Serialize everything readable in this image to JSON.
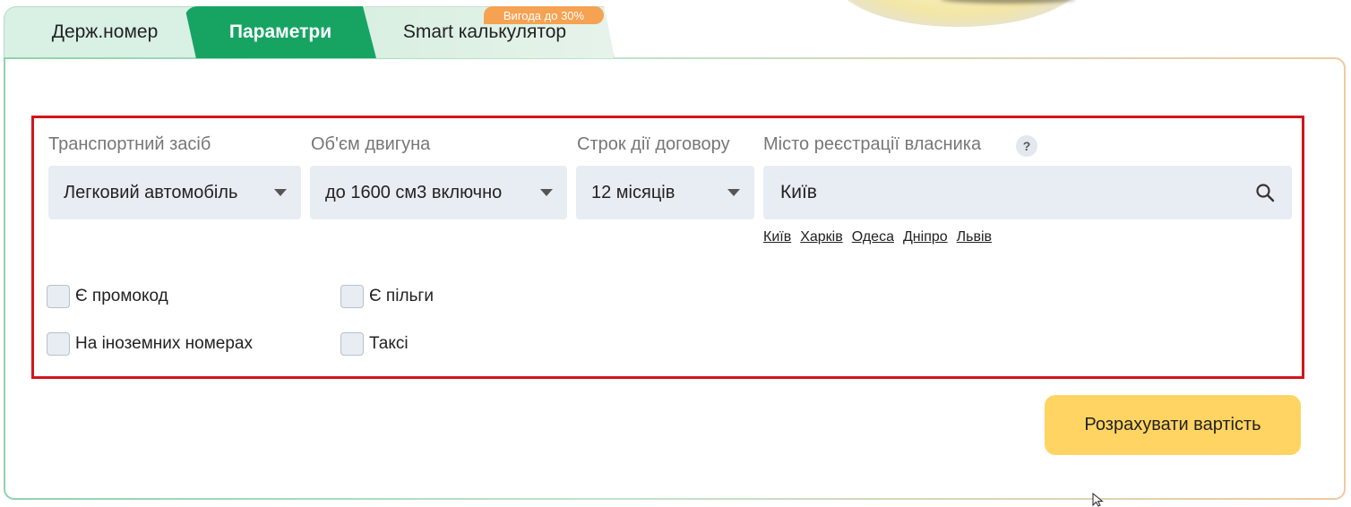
{
  "tabs": [
    {
      "label": "Держ.номер"
    },
    {
      "label": "Параметри"
    },
    {
      "label": "Smart калькулятор",
      "badge": "Вигода до 30%"
    }
  ],
  "form": {
    "vehicle": {
      "label": "Транспортний засіб",
      "value": "Легковий автомобіль"
    },
    "engine": {
      "label": "Об'єм двигуна",
      "value": "до 1600 см3 включно"
    },
    "term": {
      "label": "Строк дії договору",
      "value": "12 місяців"
    },
    "city": {
      "label": "Місто реєстрації власника",
      "help": "?",
      "value": "Київ",
      "quick": [
        "Київ",
        "Харків",
        "Одеса",
        "Дніпро",
        "Львів"
      ]
    },
    "checkboxes": {
      "promo": "Є промокод",
      "benefits": "Є пільги",
      "foreign": "На іноземних номерах",
      "taxi": "Таксі"
    }
  },
  "submit_label": "Розрахувати вартість",
  "colors": {
    "active_tab": "#17a463",
    "button": "#ffd462",
    "badge": "#f5a252",
    "highlight_border": "#d4141b"
  }
}
